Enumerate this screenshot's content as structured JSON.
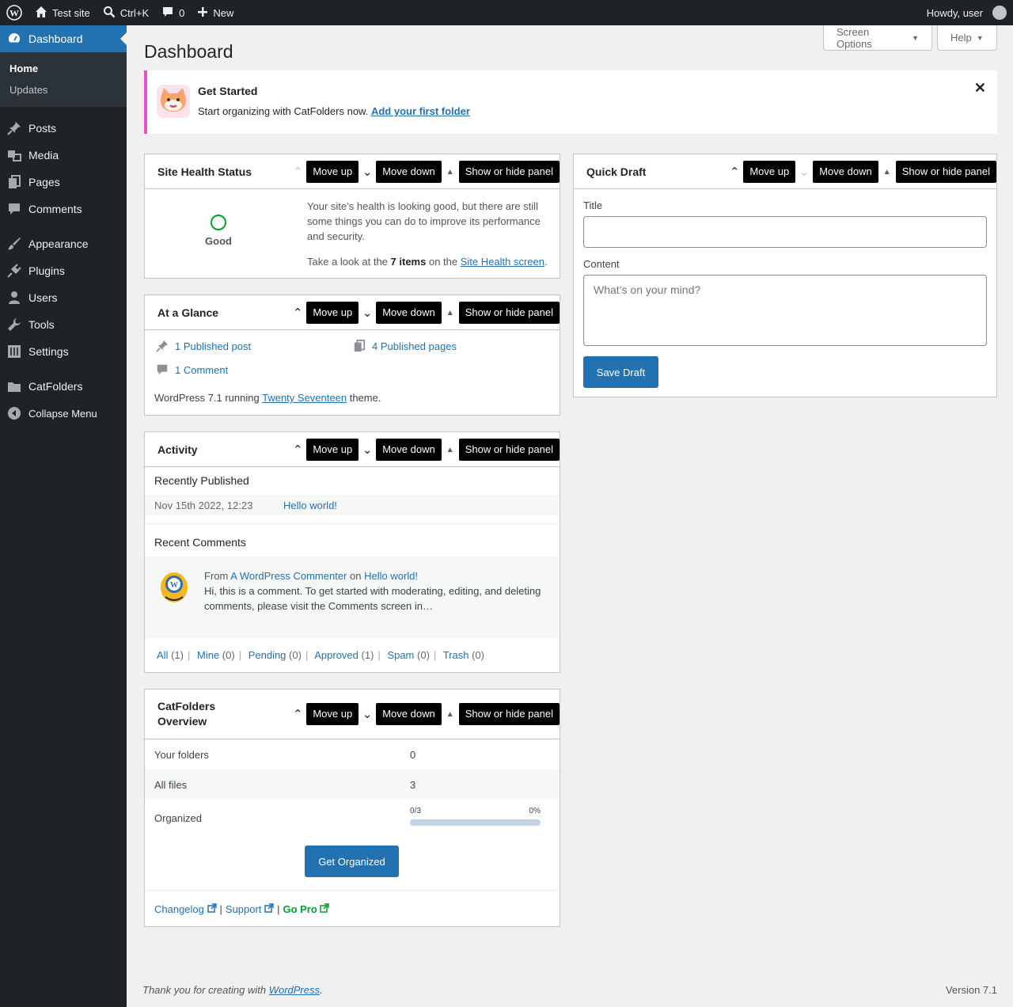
{
  "adminbar": {
    "site": "Test site",
    "search": "Ctrl+K",
    "comments_count": "0",
    "new": "New",
    "howdy": "Howdy, user"
  },
  "sidebar": {
    "dashboard": "Dashboard",
    "submenu": [
      "Home",
      "Updates"
    ],
    "items": [
      "Posts",
      "Media",
      "Pages",
      "Comments",
      "Appearance",
      "Plugins",
      "Users",
      "Tools",
      "Settings",
      "CatFolders",
      "Collapse Menu"
    ]
  },
  "header": {
    "title": "Dashboard",
    "screen_options": "Screen Options",
    "help": "Help"
  },
  "notice": {
    "title": "Get Started",
    "text": "Start organizing with CatFolders now.",
    "link": "Add your first folder"
  },
  "controls": {
    "move_up": "Move up",
    "move_down": "Move down",
    "toggle": "Show or hide panel"
  },
  "site_health": {
    "title": "Site Health Status",
    "status": "Good",
    "message": "Your site’s health is looking good, but there are still some things you can do to improve its performance and security.",
    "look_prefix": "Take a look at the",
    "items": "7 items",
    "look_mid": "on the",
    "link": "Site Health screen",
    "period": "."
  },
  "glance": {
    "title": "At a Glance",
    "posts": "1 Published post",
    "pages": "4 Published pages",
    "comments": "1 Comment",
    "version_prefix": "WordPress 7.1 running",
    "theme": "Twenty Seventeen",
    "version_suffix": "theme."
  },
  "activity": {
    "title": "Activity",
    "recently_published": "Recently Published",
    "post_date": "Nov 15th 2022, 12:23",
    "post_title": "Hello world!",
    "recent_comments": "Recent Comments",
    "comment_from": "From",
    "commenter": "A WordPress Commenter",
    "on": "on",
    "comment_post": "Hello world!",
    "comment_text": "Hi, this is a comment. To get started with moderating, editing, and deleting comments, please visit the Comments screen in…",
    "filters": [
      {
        "label": "All",
        "count": "(1)"
      },
      {
        "label": "Mine",
        "count": "(0)"
      },
      {
        "label": "Pending",
        "count": "(0)"
      },
      {
        "label": "Approved",
        "count": "(1)"
      },
      {
        "label": "Spam",
        "count": "(0)"
      },
      {
        "label": "Trash",
        "count": "(0)"
      }
    ]
  },
  "catfolders": {
    "title_line1": "CatFolders",
    "title_line2": "Overview",
    "rows": [
      {
        "label": "Your folders",
        "value": "0"
      },
      {
        "label": "All files",
        "value": "3"
      },
      {
        "label": "Organized",
        "value": ""
      }
    ],
    "progress_count": "0/3",
    "progress_percent": "0%",
    "progress_value": 0,
    "button": "Get Organized",
    "changelog": "Changelog",
    "support": "Support",
    "gopro": "Go Pro",
    "sep": "|"
  },
  "quick_draft": {
    "title": "Quick Draft",
    "title_label": "Title",
    "title_value": "",
    "content_label": "Content",
    "content_placeholder": "What’s on your mind?",
    "save": "Save Draft"
  },
  "footer": {
    "thanks": "Thank you for creating with",
    "wp": "WordPress",
    "period": ".",
    "version": "Version 7.1"
  },
  "colors": {
    "accent": "#2271b1",
    "adminbar": "#1d2327",
    "notice_border": "#e84fd0",
    "health_good": "#00a32a",
    "gopro": "#00a32a"
  }
}
